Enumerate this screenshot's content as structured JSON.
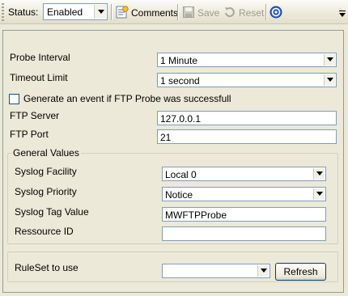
{
  "toolbar": {
    "status_label": "Status:",
    "status_value": "Enabled",
    "comments_label": "Comments",
    "save_label": "Save",
    "reset_label": "Reset",
    "icons": [
      "comments-icon",
      "save-icon",
      "reset-icon",
      "help-icon"
    ]
  },
  "form": {
    "probe_interval_label": "Probe Interval",
    "probe_interval_value": "1 Minute",
    "timeout_limit_label": "Timeout Limit",
    "timeout_limit_value": "1 second",
    "event_checkbox_label": "Generate an event if FTP Probe was successfull",
    "ftp_server_label": "FTP Server",
    "ftp_server_value": "127.0.0.1",
    "ftp_port_label": "FTP Port",
    "ftp_port_value": "21"
  },
  "general_values": {
    "legend": "General Values",
    "syslog_facility_label": "Syslog Facility",
    "syslog_facility_value": "Local 0",
    "syslog_priority_label": "Syslog Priority",
    "syslog_priority_value": "Notice",
    "syslog_tag_label": "Syslog Tag Value",
    "syslog_tag_value": "MWFTPProbe",
    "resource_id_label": "Ressource ID",
    "resource_id_value": ""
  },
  "ruleset": {
    "label": "RuleSet to use",
    "value": "",
    "refresh_label": "Refresh"
  },
  "colors": {
    "window_bg": "#ece9d8",
    "field_border": "#7f9db9",
    "disabled_text": "#9c9c8c"
  }
}
